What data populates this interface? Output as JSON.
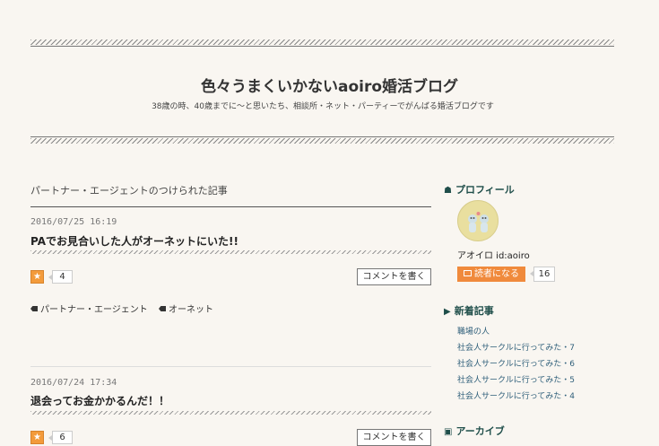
{
  "header": {
    "title": "色々うまくいかないaoiro婚活ブログ",
    "description": "38歳の時、40歳までに〜と思いたち、相談所・ネット・パーティーでがんばる婚活ブログです"
  },
  "category": {
    "heading": "パートナー・エージェントのつけられた記事"
  },
  "entries": [
    {
      "date": "2016/07/25 16:19",
      "title": "PAでお見合いした人がオーネットにいた!!",
      "star_count": "4",
      "comment_label": "コメントを書く",
      "tags": [
        "パートナー・エージェント",
        "オーネット"
      ]
    },
    {
      "date": "2016/07/24 17:34",
      "title": "退会ってお金かかるんだ！！",
      "star_count": "6",
      "comment_label": "コメントを書く"
    }
  ],
  "sidebar": {
    "profile": {
      "heading": "プロフィール",
      "name": "アオイロ  id:aoiro",
      "subscribe_label": "読者になる",
      "subscriber_count": "16"
    },
    "recent": {
      "heading": "新着記事",
      "items": [
        "職場の人",
        "社会人サークルに行ってみた・7",
        "社会人サークルに行ってみた・6",
        "社会人サークルに行ってみた・5",
        "社会人サークルに行ってみた・4"
      ]
    },
    "archive": {
      "heading": "アーカイブ"
    }
  },
  "colors": {
    "background": "#f9f6f1",
    "accent": "#f08a3c",
    "sidebar_heading": "#1f4e4a",
    "link": "#2f5f7a"
  }
}
